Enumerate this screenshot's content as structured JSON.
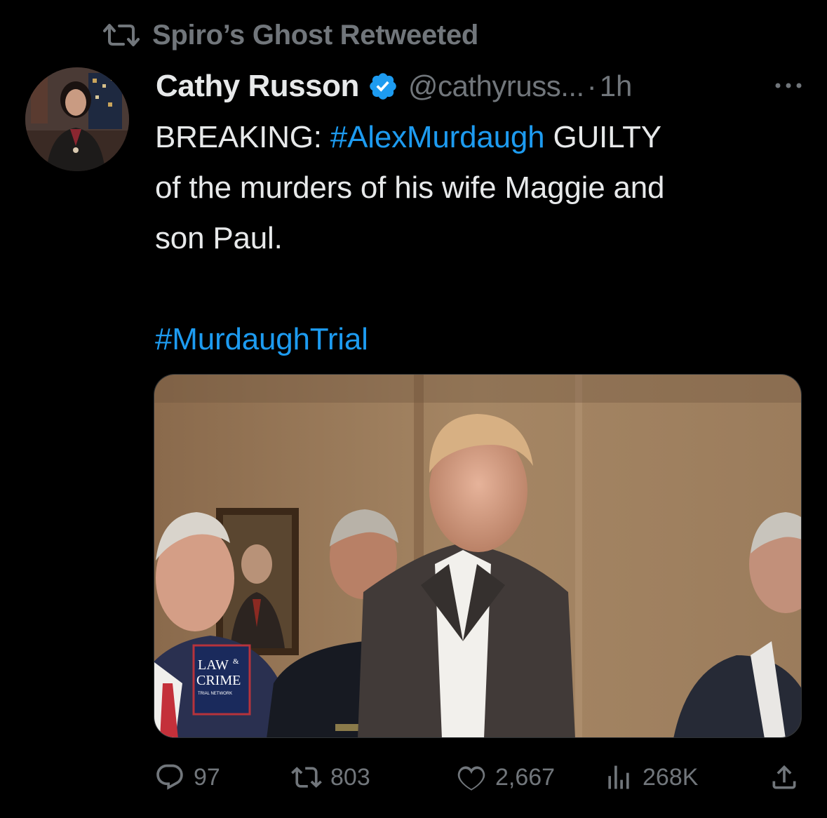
{
  "retweet_banner": {
    "text": "Spiro’s Ghost Retweeted",
    "icon": "retweet-icon"
  },
  "tweet": {
    "author": {
      "display_name": "Cathy Russon",
      "verified": true,
      "handle": "@cathyruss...",
      "avatar_icon": "avatar"
    },
    "separator": "·",
    "time": "1h",
    "more_icon": "more-dots-icon",
    "text": {
      "prefix": "BREAKING: ",
      "hashtag1": "#AlexMurdaugh",
      "after_hashtag1": " GUILTY",
      "line2": "of the murders of his wife Maggie and",
      "line3": "son Paul.",
      "hashtag2": "#MurdaughTrial"
    },
    "media": {
      "watermark_line1": "LAW",
      "watermark_amp": "&",
      "watermark_line2": "CRIME",
      "watermark_line3": "TRIAL NETWORK"
    },
    "actions": {
      "replies": "97",
      "retweets": "803",
      "likes": "2,667",
      "views": "268K"
    }
  },
  "colors": {
    "background": "#000000",
    "text_primary": "#e7e9ea",
    "text_secondary": "#71767b",
    "link": "#1d9bf0",
    "verified_badge": "#1d9bf0"
  }
}
